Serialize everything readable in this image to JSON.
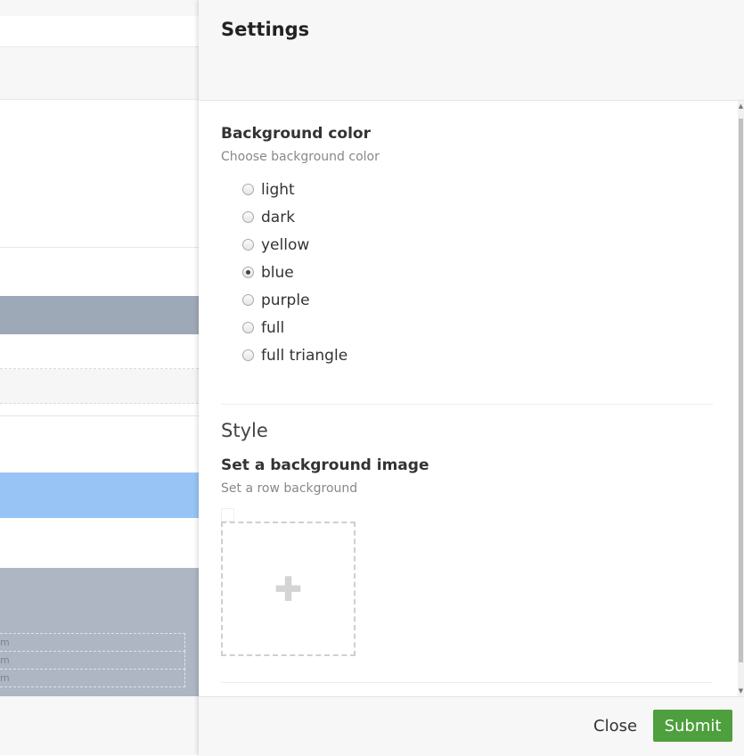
{
  "background_page": {
    "row_labels": [
      "m",
      "m",
      "m"
    ]
  },
  "settings_panel": {
    "title": "Settings",
    "background_color": {
      "label": "Background color",
      "help": "Choose background color",
      "options": [
        "light",
        "dark",
        "yellow",
        "blue",
        "purple",
        "full",
        "full triangle"
      ],
      "selected": "blue"
    },
    "style": {
      "heading": "Style",
      "background_image": {
        "label": "Set a background image",
        "help": "Set a row background"
      }
    },
    "footer": {
      "close_label": "Close",
      "submit_label": "Submit"
    },
    "colors": {
      "submit": "#4e9f3d",
      "header_bg": "#f7f7f7"
    }
  }
}
